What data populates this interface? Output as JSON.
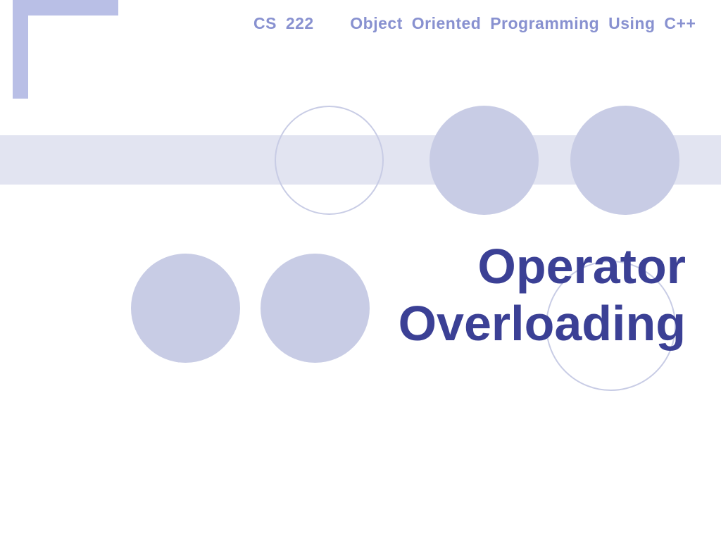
{
  "header": {
    "course_code": "CS 222",
    "course_name": "Object  Oriented  Programming  Using C++"
  },
  "title": {
    "line1": "Operator",
    "line2": "Overloading"
  },
  "colors": {
    "accent_light": "#b9bfe6",
    "accent_text": "#8891d0",
    "band": "#e2e4f1",
    "circle_fill": "#c8cce5",
    "title_color": "#3b4095"
  }
}
